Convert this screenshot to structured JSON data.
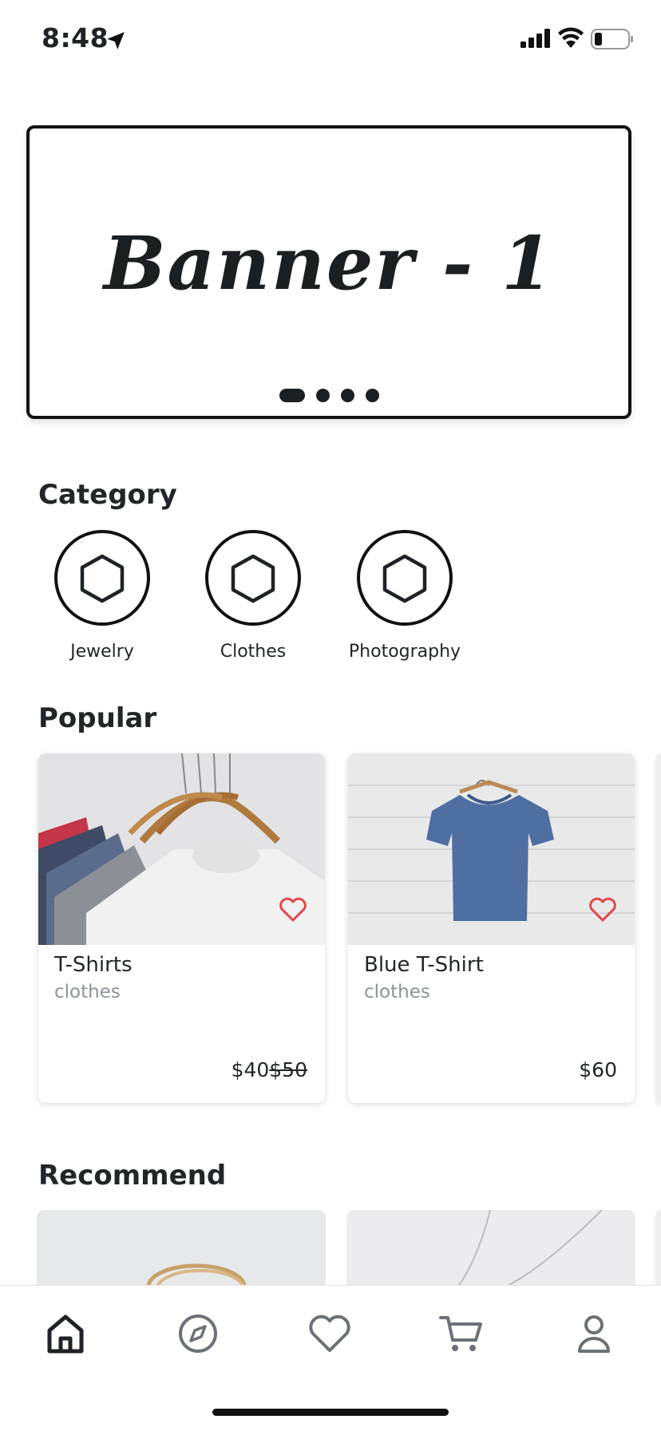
{
  "status_bar": {
    "time": "8:48"
  },
  "banner": {
    "title": "Banner - 1",
    "page_count": 4,
    "active_page": 1
  },
  "category": {
    "title": "Category",
    "items": [
      {
        "label": "Jewelry",
        "icon": "hexagon-icon"
      },
      {
        "label": "Clothes",
        "icon": "hexagon-icon"
      },
      {
        "label": "Photography",
        "icon": "hexagon-icon"
      }
    ]
  },
  "popular": {
    "title": "Popular",
    "products": [
      {
        "name": "T-Shirts",
        "category": "clothes",
        "price": "$40",
        "old_price": "$50",
        "image": "hanging-tshirts-photo",
        "favorite_icon": "heart-outline-icon"
      },
      {
        "name": "Blue T-Shirt",
        "category": "clothes",
        "price": "$60",
        "image": "blue-tshirt-on-hanger-photo",
        "favorite_icon": "heart-outline-icon"
      }
    ]
  },
  "recommend": {
    "title": "Recommend",
    "images": [
      "gold-rings-photo",
      "necklace-photo"
    ]
  },
  "tab_bar": {
    "items": [
      {
        "name": "home",
        "icon": "home-icon",
        "active": true
      },
      {
        "name": "explore",
        "icon": "compass-icon",
        "active": false
      },
      {
        "name": "favorites",
        "icon": "heart-icon",
        "active": false
      },
      {
        "name": "cart",
        "icon": "cart-icon",
        "active": false
      },
      {
        "name": "profile",
        "icon": "user-icon",
        "active": false
      }
    ]
  },
  "colors": {
    "heart": "#e0474c",
    "text": "#22262b",
    "muted": "#8d939b",
    "tab_inactive": "#6c7178"
  }
}
